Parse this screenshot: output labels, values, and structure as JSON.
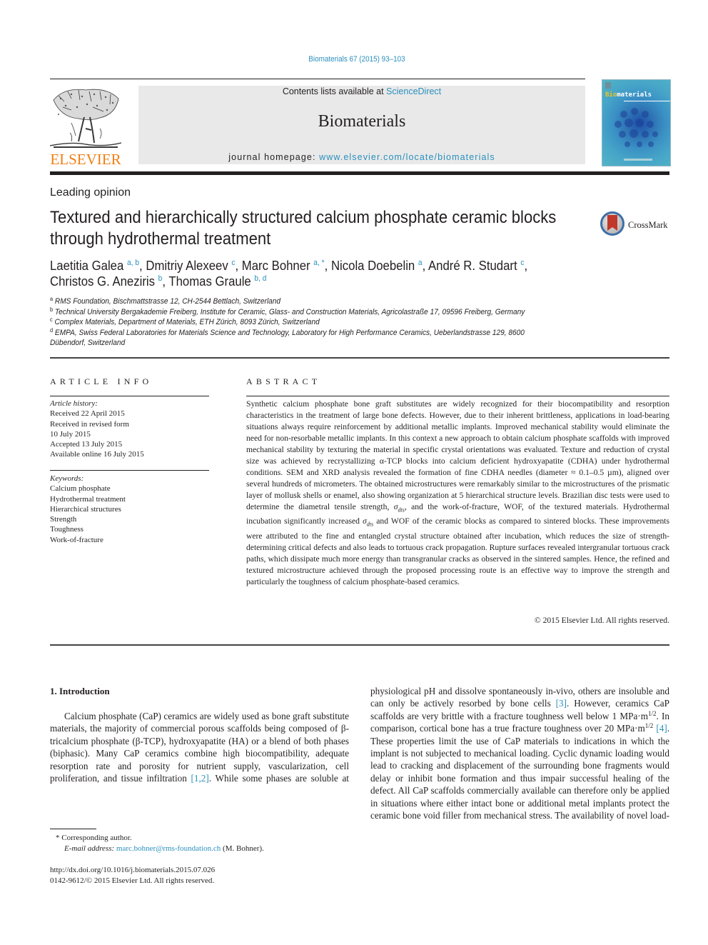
{
  "header": {
    "citation": "Biomaterials 67 (2015) 93–103",
    "contents_prefix": "Contents lists available at ",
    "contents_link": "ScienceDirect",
    "journal_name": "Biomaterials",
    "homepage_prefix": "journal homepage: ",
    "homepage_link": "www.elsevier.com/locate/biomaterials",
    "publisher_logo_text": "ELSEVIER",
    "cover": {
      "title_highlight": "Bio",
      "title_rest": "materials"
    },
    "colors": {
      "link": "#2a8fbd",
      "elsevier_orange": "#f07f13",
      "banner_bg": "#e9e9e9"
    }
  },
  "article": {
    "section_type": "Leading opinion",
    "title": "Textured and hierarchically structured calcium phosphate ceramic blocks through hydrothermal treatment",
    "crossmark_label": "CrossMark",
    "authors": [
      {
        "name": "Laetitia Galea",
        "affil": "a, b",
        "sep": ", "
      },
      {
        "name": "Dmitriy Alexeev",
        "affil": "c",
        "sep": ", "
      },
      {
        "name": "Marc Bohner",
        "affil": "a, *",
        "sep": ", "
      },
      {
        "name": "Nicola Doebelin",
        "affil": "a",
        "sep": ", "
      },
      {
        "name": "André R. Studart",
        "affil": "c",
        "sep": ","
      },
      {
        "name": "Christos G. Aneziris",
        "affil": "b",
        "sep": ", "
      },
      {
        "name": "Thomas Graule",
        "affil": "b, d",
        "sep": ""
      }
    ],
    "affiliations": [
      {
        "key": "a",
        "text": "RMS Foundation, Bischmattstrasse 12, CH-2544 Bettlach, Switzerland"
      },
      {
        "key": "b",
        "text": "Technical University Bergakademie Freiberg, Institute for Ceramic, Glass- and Construction Materials, Agricolastraße 17, 09596 Freiberg, Germany"
      },
      {
        "key": "c",
        "text": "Complex Materials, Department of Materials, ETH Zürich, 8093 Zürich, Switzerland"
      },
      {
        "key": "d",
        "text": "EMPA, Swiss Federal Laboratories for Materials Science and Technology, Laboratory for High Performance Ceramics, Ueberlandstrasse 129, 8600 Dübendorf, Switzerland"
      }
    ]
  },
  "article_info": {
    "heading": "ARTICLE INFO",
    "history_label": "Article history:",
    "history": [
      "Received 22 April 2015",
      "Received in revised form",
      "10 July 2015",
      "Accepted 13 July 2015",
      "Available online 16 July 2015"
    ],
    "keywords_label": "Keywords:",
    "keywords": [
      "Calcium phosphate",
      "Hydrothermal treatment",
      "Hierarchical structures",
      "Strength",
      "Toughness",
      "Work-of-fracture"
    ]
  },
  "abstract": {
    "heading": "ABSTRACT",
    "p1": "Synthetic calcium phosphate bone graft substitutes are widely recognized for their biocompatibility and resorption characteristics in the treatment of large bone defects. However, due to their inherent brit­tleness, applications in load-bearing situations always require reinforcement by additional metallic implants. Improved mechanical stability would eliminate the need for non-resorbable metallic implants. In this context a new approach to obtain calcium phosphate scaffolds with improved mechanical stability by texturing the material in specific crystal orientations was evaluated. Texture and reduction of crystal size was achieved by recrystallizing α-TCP blocks into calcium deficient hydroxyapatite (CDHA) under hydrothermal conditions. SEM and XRD analysis revealed the formation of fine CDHA needles (diameter ≈ 0.1–0.5 µm), aligned over several hundreds of micrometers. The obtained microstructures were remarkably similar to the microstructures of the prismatic layer of mollusk shells or enamel, also showing organization at 5 hierarchical structure levels. Brazilian disc tests were used to determine the diametral tensile strength, ",
    "sigma": "σ",
    "sigma_sub": "dts",
    "p2": ", and the work-of-fracture, WOF, of the textured materials. Hydrothermal incubation significantly increased ",
    "p3": " and WOF of the ceramic blocks as compared to sintered blocks. These improvements were attributed to the fine and entangled crystal structure obtained after incu­bation, which reduces the size of strength-determining critical defects and also leads to tortuous crack propagation. Rupture surfaces revealed intergranular tortuous crack paths, which dissipate much more energy than transgranular cracks as observed in the sintered samples. Hence, the refined and textured microstructure achieved through the proposed processing route is an effective way to improve the strength and particularly the toughness of calcium phosphate-based ceramics.",
    "copyright": "© 2015 Elsevier Ltd. All rights reserved."
  },
  "body": {
    "section_heading": "1.  Introduction",
    "left_text_a": "Calcium phosphate (CaP) ceramics are widely used as bone graft substitute materials, the majority of commercial porous scaffolds being composed of β-tricalcium phosphate (β-TCP), hydroxyapatite (HA) or a blend of both phases (biphasic). Many CaP ceramics combine high biocompatibility, adequate resorption rate and porosity for nutrient supply, vascularization, cell proliferation, and tissue infiltration ",
    "left_ref": "[1,2]",
    "left_text_b": ". While some phases are soluble at",
    "right_text_a": "physiological pH and dissolve spontaneously in-vivo, others are insoluble and can only be actively resorbed by bone cells ",
    "right_ref_1": "[3]",
    "right_text_b": ". However, ceramics CaP scaffolds are very brittle with a fracture toughness well below 1 MPa·m",
    "exp": "1/2",
    "right_text_c": ". In comparison, cortical bone has a true fracture toughness over 20 MPa·m",
    "right_ref_2": "[4]",
    "right_text_d": ". These properties limit the use of CaP materials to indications in which the implant is not subjected to mechanical loading. Cyclic dynamic loading would lead to cracking and displacement of the surrounding bone frag­ments would delay or inhibit bone formation and thus impair successful healing of the defect. All CaP scaffolds commercially available can therefore only be applied in situations where either intact bone or additional metal implants protect the ceramic bone void filler from mechanical stress. The availability of novel load-"
  },
  "footnotes": {
    "corresponding": "* Corresponding author.",
    "email_label": "E-mail address: ",
    "email": "marc.bohner@rms-foundation.ch",
    "email_suffix": " (M. Bohner).",
    "doi": "http://dx.doi.org/10.1016/j.biomaterials.2015.07.026",
    "issn": "0142-9612/© 2015 Elsevier Ltd. All rights reserved."
  }
}
